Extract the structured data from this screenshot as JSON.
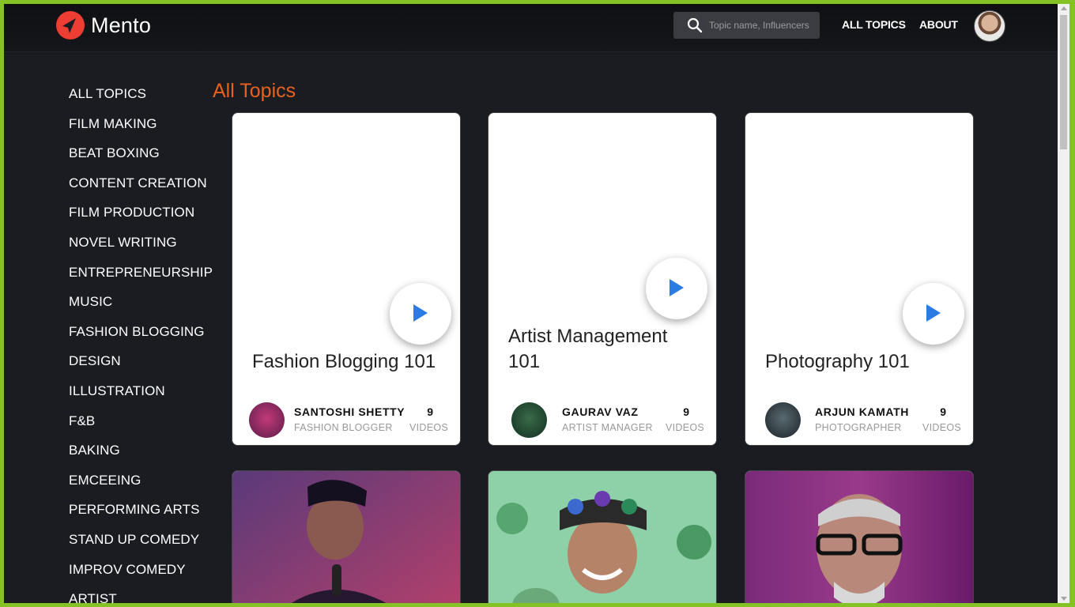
{
  "app": {
    "name": "Mento"
  },
  "header": {
    "search_placeholder": "Topic name, Influencers",
    "nav": [
      {
        "label": "ALL TOPICS"
      },
      {
        "label": "ABOUT"
      }
    ]
  },
  "sidebar": {
    "items": [
      {
        "label": "ALL TOPICS"
      },
      {
        "label": "FILM MAKING"
      },
      {
        "label": "BEAT BOXING"
      },
      {
        "label": "CONTENT CREATION"
      },
      {
        "label": "FILM PRODUCTION"
      },
      {
        "label": "NOVEL WRITING"
      },
      {
        "label": "ENTREPRENEURSHIP"
      },
      {
        "label": "MUSIC"
      },
      {
        "label": "FASHION BLOGGING"
      },
      {
        "label": "DESIGN"
      },
      {
        "label": "ILLUSTRATION"
      },
      {
        "label": "F&B"
      },
      {
        "label": "BAKING"
      },
      {
        "label": "EMCEEING"
      },
      {
        "label": "PERFORMING ARTS"
      },
      {
        "label": "STAND UP COMEDY"
      },
      {
        "label": "IMPROV COMEDY"
      },
      {
        "label": "ARTIST"
      }
    ]
  },
  "main": {
    "title": "All Topics",
    "cards": [
      {
        "title": "Fashion Blogging 101",
        "author": "SANTOSHI SHETTY",
        "role": "FASHION BLOGGER",
        "count": "9",
        "count_label": "VIDEOS"
      },
      {
        "title": "Artist Management 101",
        "author": "GAURAV VAZ",
        "role": "ARTIST MANAGER",
        "count": "9",
        "count_label": "VIDEOS"
      },
      {
        "title": "Photography 101",
        "author": "ARJUN KAMATH",
        "role": "PHOTOGRAPHER",
        "count": "9",
        "count_label": "VIDEOS"
      }
    ]
  },
  "colors": {
    "accent": "#e8621c",
    "play_icon": "#2a7be4",
    "background": "#1b1c22",
    "frame": "#84c225"
  },
  "icons": [
    "logo-icon",
    "search-icon",
    "play-icon",
    "avatar"
  ]
}
